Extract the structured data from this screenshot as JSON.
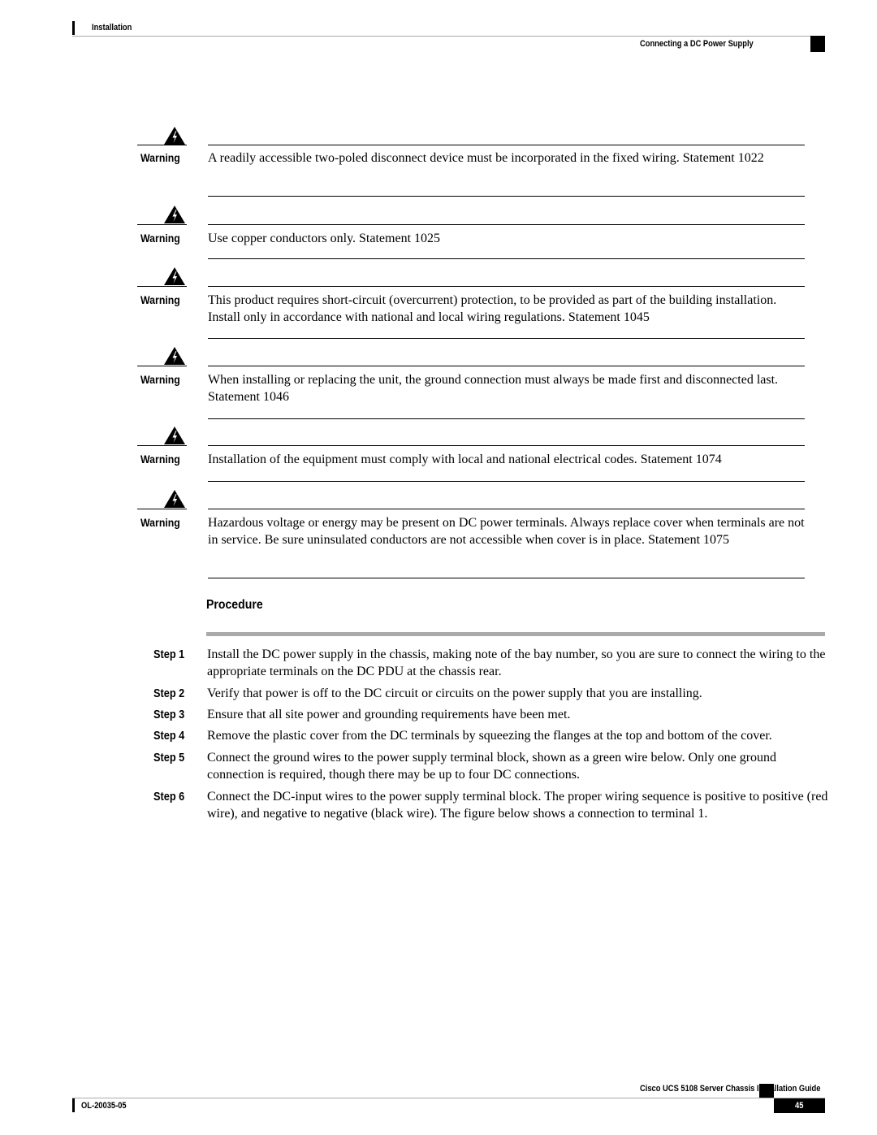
{
  "header": {
    "section": "Installation",
    "topic": "Connecting a DC Power Supply"
  },
  "warnings": [
    {
      "label": "Warning",
      "icon": "warning-triangle-icon",
      "text": "A readily accessible two-poled disconnect device must be incorporated in the fixed wiring. Statement 1022"
    },
    {
      "label": "Warning",
      "icon": "warning-triangle-icon",
      "text": "Use copper conductors only. Statement 1025"
    },
    {
      "label": "Warning",
      "icon": "warning-triangle-icon",
      "text": "This product requires short-circuit (overcurrent) protection, to be provided as part of the building installation. Install only in accordance with national and local wiring regulations. Statement 1045"
    },
    {
      "label": "Warning",
      "icon": "warning-triangle-icon",
      "text": "When installing or replacing the unit, the ground connection must always be made first and disconnected last. Statement 1046"
    },
    {
      "label": "Warning",
      "icon": "warning-triangle-icon",
      "text": "Installation of the equipment must comply with local and national electrical codes. Statement 1074"
    },
    {
      "label": "Warning",
      "icon": "warning-triangle-icon",
      "text": "Hazardous voltage or energy may be present on DC power terminals. Always replace cover when terminals are not in service. Be sure uninsulated conductors are not accessible when cover is in place. Statement 1075"
    }
  ],
  "procedure": {
    "title": "Procedure",
    "steps": [
      {
        "label": "Step 1",
        "text": "Install the DC power supply in the chassis, making note of the bay number, so you are sure to connect the wiring to the appropriate terminals on the DC PDU at the chassis rear."
      },
      {
        "label": "Step 2",
        "text": "Verify that power is off to the DC circuit or circuits on the power supply that you are installing."
      },
      {
        "label": "Step 3",
        "text": "Ensure that all site power and grounding requirements have been met."
      },
      {
        "label": "Step 4",
        "text": "Remove the plastic cover from the DC terminals by squeezing the flanges at the top and bottom of the cover."
      },
      {
        "label": "Step 5",
        "text": "Connect the ground wires to the power supply terminal block, shown as a green wire below. Only one ground connection is required, though there may be up to four DC connections."
      },
      {
        "label": "Step 6",
        "text": "Connect the DC-input wires to the power supply terminal block. The proper wiring sequence is positive to positive (red wire), and negative to negative (black wire). The figure below shows a connection to terminal 1."
      }
    ]
  },
  "footer": {
    "guide_title": "Cisco UCS 5108 Server Chassis Installation Guide",
    "doc_number": "OL-20035-05",
    "page_number": "45"
  }
}
